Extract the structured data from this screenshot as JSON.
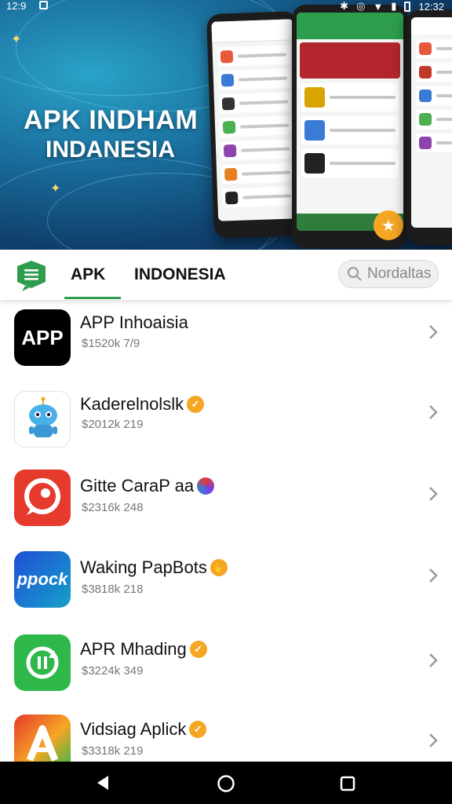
{
  "status_bar": {
    "time_left": "12:9",
    "time_right": "12:32"
  },
  "hero": {
    "title": "APK INDHAM",
    "subtitle": "INDANESIA",
    "colors": {
      "bg": "#1a6f9e",
      "accent": "#ffd96a"
    }
  },
  "header": {
    "logo_icon": "menu-chat-icon",
    "tabs": [
      {
        "label": "APK",
        "active": true
      },
      {
        "label": "INDONESIA",
        "active": false
      }
    ],
    "search": {
      "placeholder": "Nordaltas",
      "icon": "search-icon"
    },
    "accent_color": "#2e9d4e"
  },
  "apps": [
    {
      "name": "APP Inhoaisia",
      "meta": "$1520k 7/9",
      "icon_text": "APP",
      "badge": null
    },
    {
      "name": "Kaderelnolslk",
      "meta": "$2012k 219",
      "icon_text": "",
      "badge": "verified"
    },
    {
      "name": "Gitte CaraP aa",
      "meta": "$2316k 248",
      "icon_text": "",
      "badge": "circle"
    },
    {
      "name": "Waking PapBots",
      "meta": "$3818k 218",
      "icon_text": "ppock",
      "badge": "hand"
    },
    {
      "name": "APR Mhading",
      "meta": "$3224k 349",
      "icon_text": "",
      "badge": "verified"
    },
    {
      "name": "Vidsiag Aplick",
      "meta": "$3318k 219",
      "icon_text": "",
      "badge": "verified"
    }
  ],
  "system_nav": {
    "back_icon": "back-triangle-icon",
    "home_icon": "home-circle-icon",
    "recents_icon": "recents-square-icon"
  }
}
